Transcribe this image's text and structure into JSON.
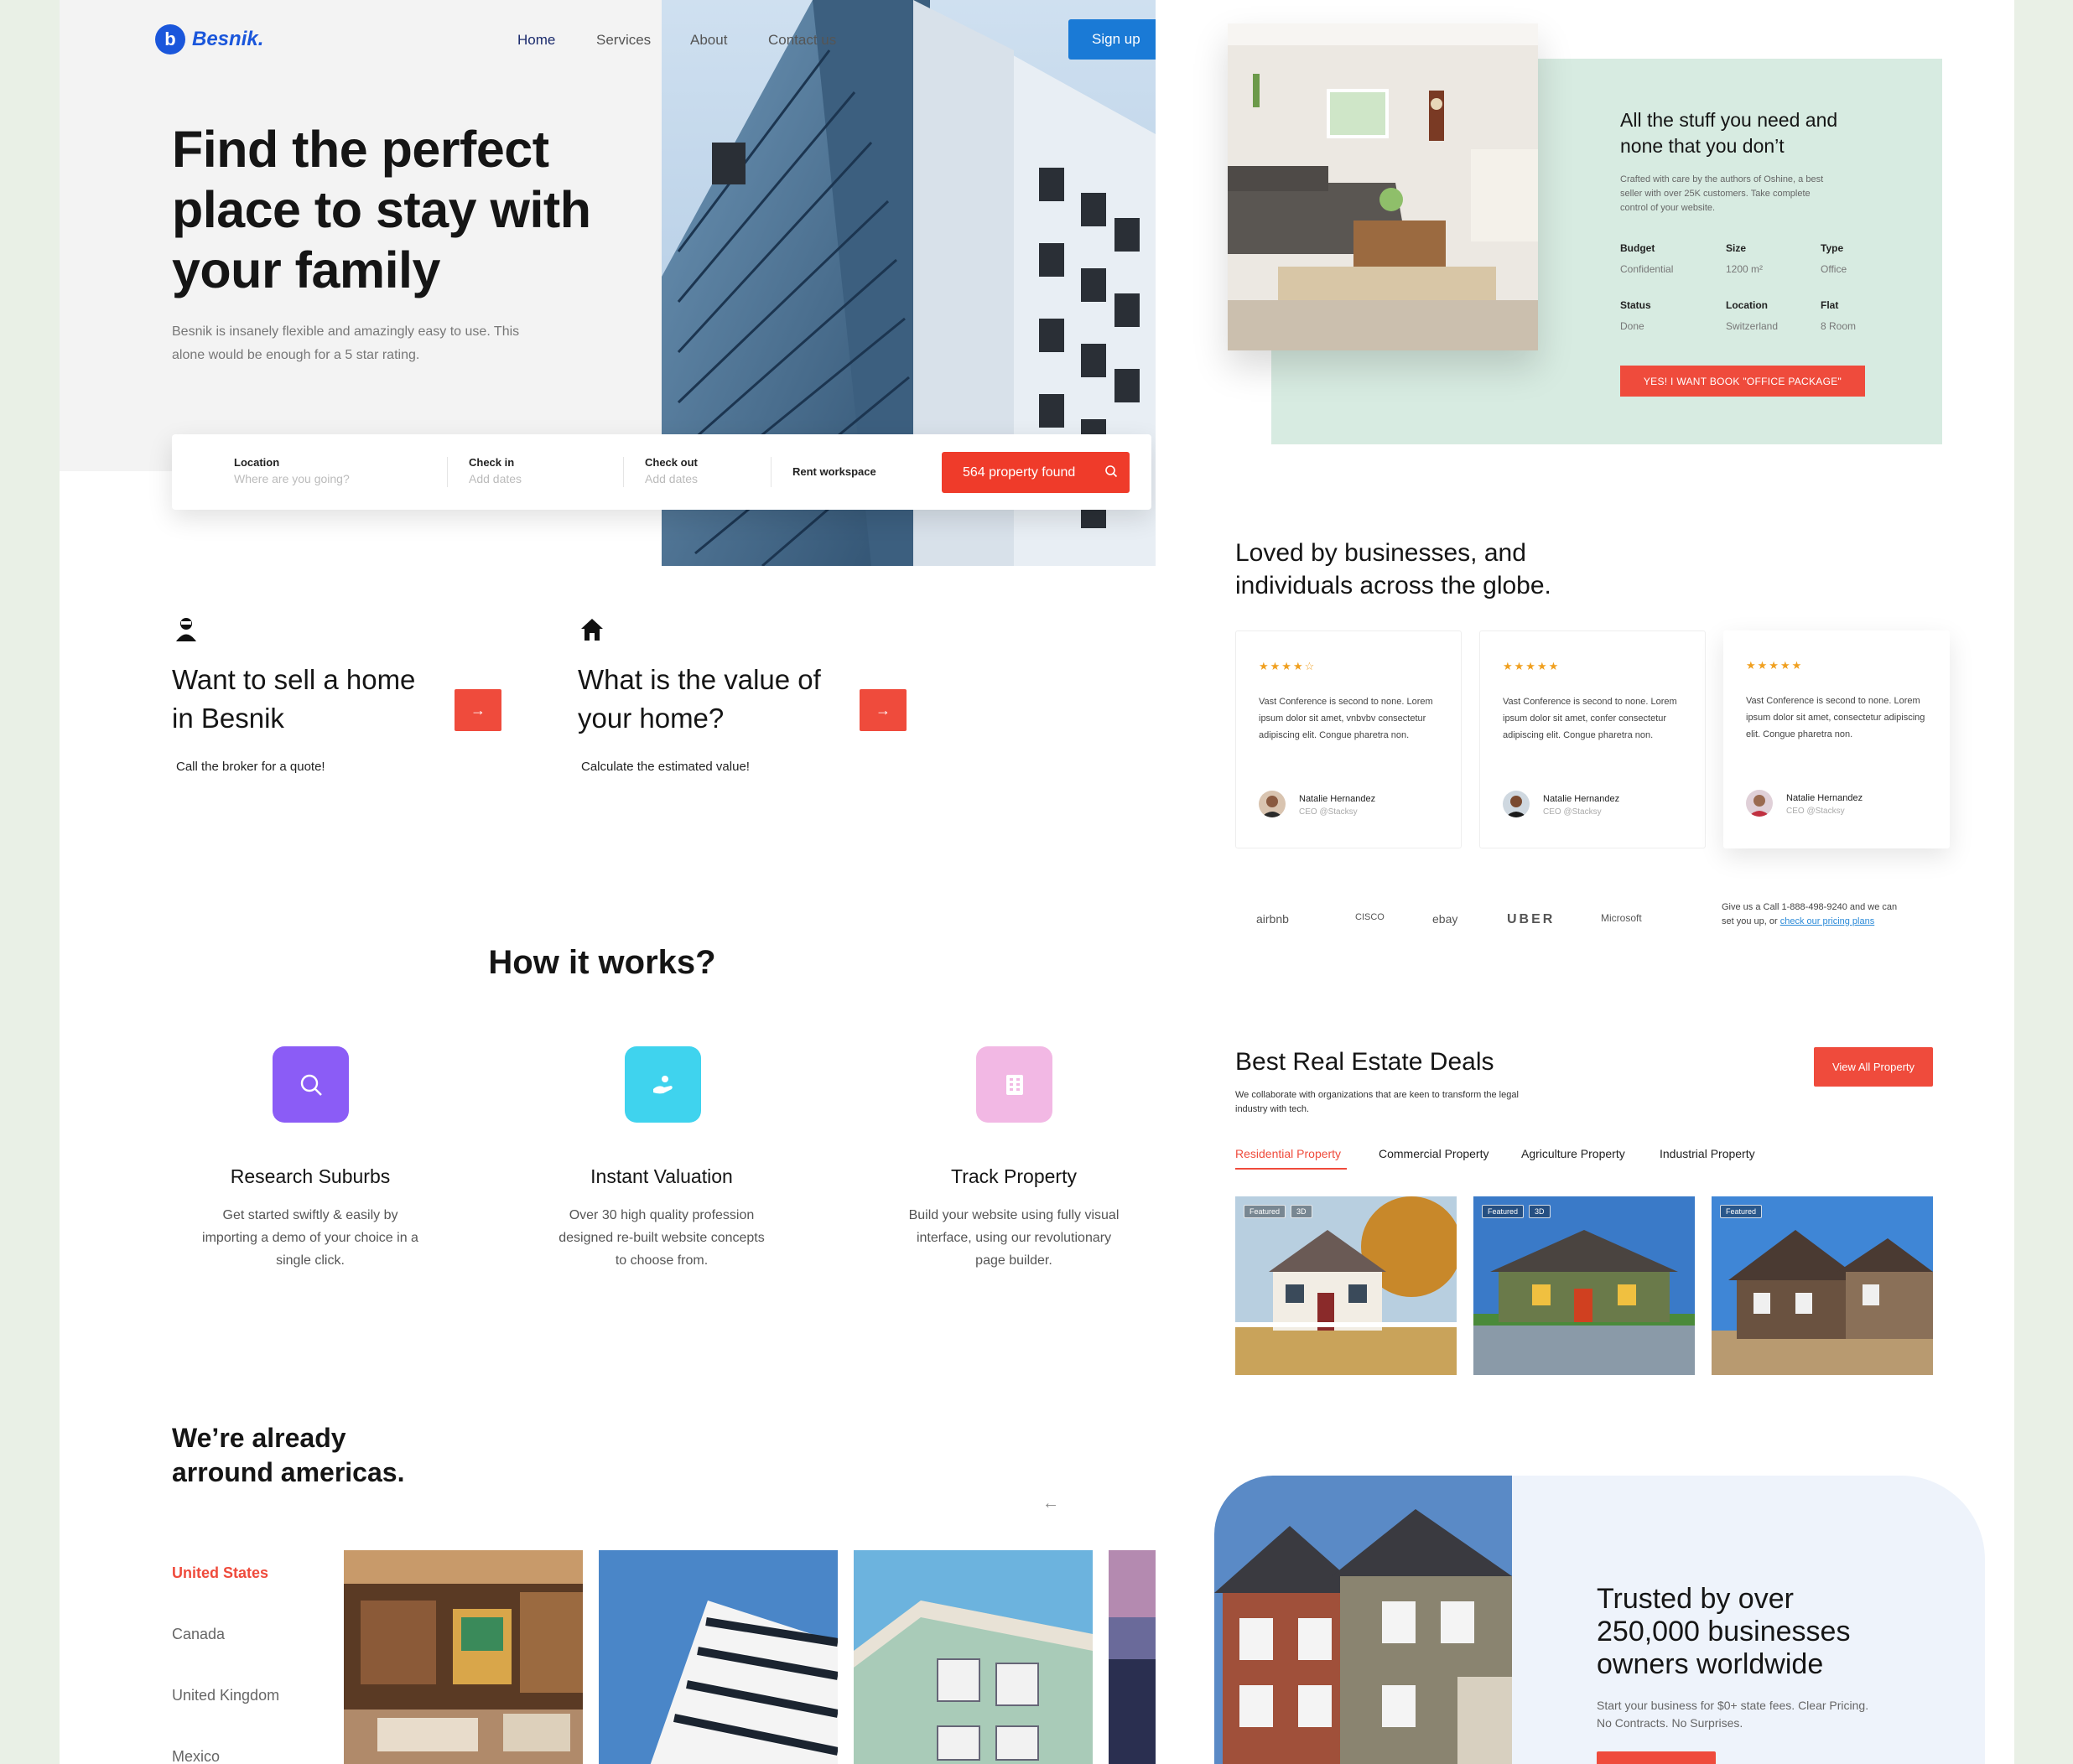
{
  "brand": {
    "name": "Besnik.",
    "mark": "b"
  },
  "nav": {
    "items": [
      {
        "label": "Home"
      },
      {
        "label": "Services"
      },
      {
        "label": "About"
      },
      {
        "label": "Contact us"
      }
    ],
    "signup": "Sign up"
  },
  "hero": {
    "title": "Find the perfect place to stay with your family",
    "subtitle": "Besnik is insanely flexible and amazingly easy to use. This alone would be enough for a 5 star rating."
  },
  "search": {
    "location_label": "Location",
    "location_placeholder": "Where are you going?",
    "checkin_label": "Check in",
    "checkin_placeholder": "Add dates",
    "checkout_label": "Check out",
    "checkout_placeholder": "Add dates",
    "workspace_label": "Rent workspace",
    "button": "564 property found",
    "icons": [
      "search-icon"
    ]
  },
  "features": [
    {
      "icon": "person-icon",
      "title": "Want to sell a home in Besnik",
      "text": "Call the broker for a quote!",
      "arrow": "→"
    },
    {
      "icon": "house-icon",
      "title": "What is the value of your home?",
      "text": "Calculate the estimated value!",
      "arrow": "→"
    }
  ],
  "how": {
    "title": "How it works?",
    "steps": [
      {
        "icon": "search-icon",
        "color": "#8b5cf6",
        "title": "Research Suburbs",
        "text": "Get started swiftly & easily by importing a  demo of your choice in a single click."
      },
      {
        "icon": "hand-icon",
        "color": "#3fd3ee",
        "title": "Instant Valuation",
        "text": "Over 30 high quality profession designed re-built website concepts to choose from."
      },
      {
        "icon": "building-icon",
        "color": "#f2b8e4",
        "title": "Track Property",
        "text": "Build your website using fully visual interface, using our revolutionary page builder."
      }
    ]
  },
  "americas": {
    "title": "We’re already arround americas.",
    "back_arrow": "←",
    "countries": [
      "United States",
      "Canada",
      "United Kingdom",
      "Mexico"
    ]
  },
  "package": {
    "title": "All the stuff you need and none that you don’t",
    "text": "Crafted with care by the authors of Oshine, a best seller with over 25K customers. Take complete control of your website.",
    "specs": [
      {
        "label": "Budget",
        "value": "Confidential"
      },
      {
        "label": "Size",
        "value": "1200 m²"
      },
      {
        "label": "Type",
        "value": "Office"
      },
      {
        "label": "Status",
        "value": "Done"
      },
      {
        "label": "Location",
        "value": "Switzerland"
      },
      {
        "label": "Flat",
        "value": "8 Room"
      }
    ],
    "button": "YES! I WANT BOOK \"OFFICE PACKAGE\""
  },
  "loved": {
    "title": "Loved by businesses, and individuals across the globe.",
    "testimonials": [
      {
        "stars": "★★★★☆",
        "rating": 4,
        "quote": "Vast Conference is second to none. Lorem ipsum dolor sit amet, vnbvbv consectetur adipiscing elit. Congue pharetra non.",
        "name": "Natalie Hernandez",
        "role": "CEO @Stacksy"
      },
      {
        "stars": "★★★★★",
        "rating": 5,
        "quote": "Vast Conference is second to none. Lorem ipsum dolor sit amet, confer consectetur adipiscing elit. Congue pharetra non.",
        "name": "Natalie Hernandez",
        "role": "CEO @Stacksy"
      },
      {
        "stars": "★★★★★",
        "rating": 5,
        "quote": "Vast Conference is second to none. Lorem ipsum dolor sit amet, consectetur adipiscing elit. Congue pharetra non.",
        "name": "Natalie Hernandez",
        "role": "CEO @Stacksy"
      }
    ],
    "brands": [
      "airbnb",
      "CISCO",
      "ebay",
      "UBER",
      "Microsoft"
    ],
    "cta_text": "Give us a Call 1-888-498-9240 and we can set you up, or",
    "cta_link": "check our pricing plans"
  },
  "deals": {
    "title": "Best Real Estate Deals",
    "text": "We collaborate with organizations that are keen to transform the legal industry with tech.",
    "button": "View All Property",
    "tabs": [
      "Residential Property",
      "Commercial Property",
      "Agriculture Property",
      "Industrial Property"
    ],
    "badges": [
      "Featured",
      "3D",
      "Featured",
      "3D",
      "Featured"
    ]
  },
  "trust": {
    "title": "Trusted by over 250,000 businesses owners worldwide",
    "text": "Start your business for $0+ state fees. Clear Pricing. No Contracts. No Surprises."
  },
  "colors": {
    "accent": "#ef4b3c",
    "primary": "#1a56db",
    "signup": "#1a7ad6",
    "mint": "#d7ebe1"
  }
}
